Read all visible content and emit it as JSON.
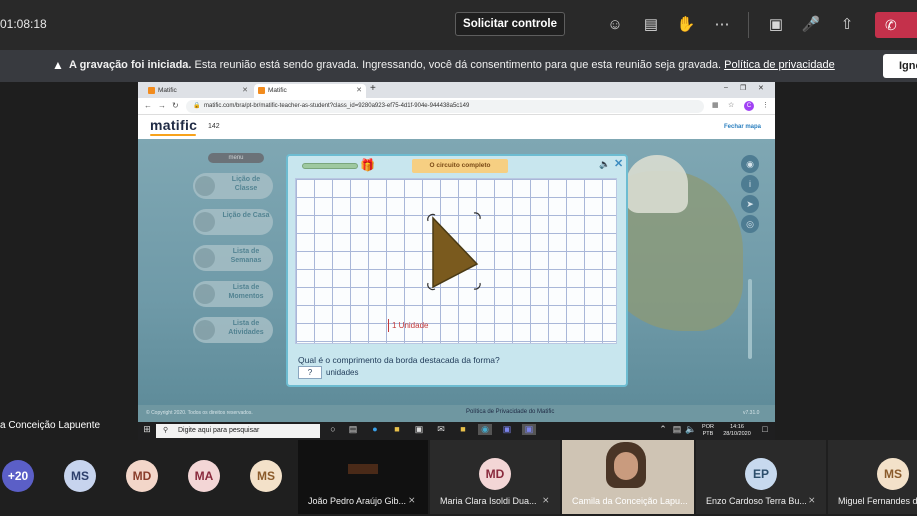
{
  "teams": {
    "timer": "01:08:18",
    "request_control": "Solicitar controle",
    "icons": [
      "participants-icon",
      "chat-icon",
      "raise-hand-icon",
      "more-icon",
      "camera-off-icon",
      "mic-off-icon",
      "share-tray-icon",
      "hang-up-icon"
    ]
  },
  "banner": {
    "bold": "A gravação foi iniciada.",
    "text": " Esta reunião está sendo gravada. Ingressando, você dá consentimento para que esta reunião seja gravada. ",
    "link": "Política de privacidade",
    "ignore": "Igno"
  },
  "presenter_name": "a Conceição Lapuente",
  "browser": {
    "tab1": "Matific",
    "tab2": "Matific",
    "url": "matific.com/bra/pt-br/matific-teacher-as-student?class_id=9280a923-ef75-4d1f-904e-944438a5c149",
    "avatar_letter": "C"
  },
  "site": {
    "logo": "matific",
    "coins": "142",
    "close_map": "Fechar mapa",
    "menu_title": "menu",
    "menu_items": [
      "Lição de Classe",
      "Lição de Casa",
      "Lista de Semanas",
      "Lista de Momentos",
      "Lista de Atividades"
    ],
    "footer_copy": "© Copyright 2020. Todos os direitos reservados.",
    "footer_privacy": "Política de Privacidade do Matific",
    "footer_version": "v7.31.0"
  },
  "activity": {
    "title": "O circuito completo",
    "unit_label": "1 Unidade",
    "question": "Qual é o comprimento da borda destacada da forma?",
    "answer": "?",
    "unit_word": "unidades",
    "triangle_color": "#7a5a1e"
  },
  "taskbar": {
    "search_placeholder": "Digite aqui para pesquisar",
    "lang": "POR",
    "lang2": "PTB",
    "time": "14:16",
    "date": "28/10/2020"
  },
  "participants": {
    "overflow": "+20",
    "avatars": [
      "MS",
      "MD",
      "MA",
      "MS"
    ],
    "tiles": [
      {
        "name": "João Pedro Araújo Gib...",
        "initials": ""
      },
      {
        "name": "Maria Clara Isoldi Dua...",
        "initials": "MD"
      },
      {
        "name": "Camila da Conceição Lapu...",
        "initials": ""
      },
      {
        "name": "Enzo Cardoso Terra Bu...",
        "initials": "EP"
      },
      {
        "name": "Miguel Fernandes de",
        "initials": "MS"
      }
    ]
  }
}
